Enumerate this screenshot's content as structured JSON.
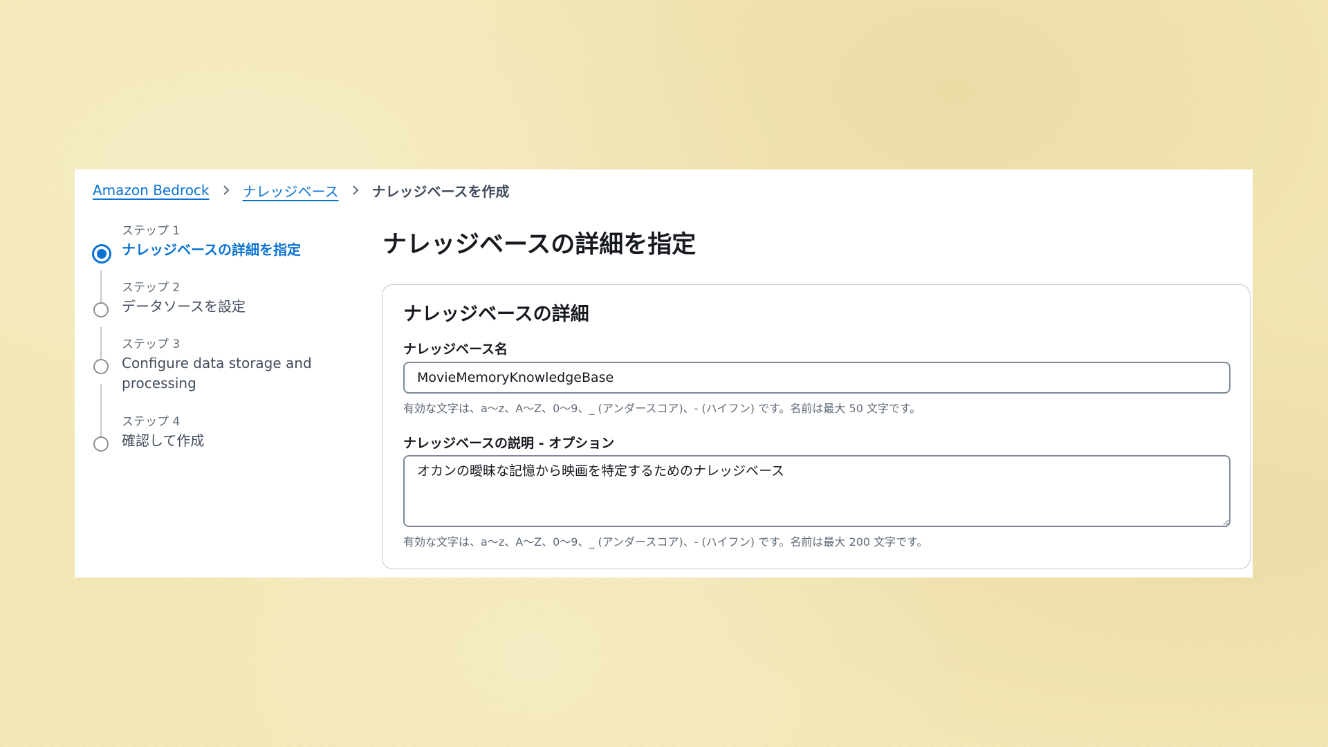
{
  "breadcrumb": {
    "items": [
      {
        "label": "Amazon Bedrock"
      },
      {
        "label": "ナレッジベース"
      }
    ],
    "current": "ナレッジベースを作成"
  },
  "steps": [
    {
      "label": "ステップ 1",
      "title": "ナレッジベースの詳細を指定",
      "state": "active"
    },
    {
      "label": "ステップ 2",
      "title": "データソースを設定",
      "state": "inactive"
    },
    {
      "label": "ステップ 3",
      "title": "Configure data storage and processing",
      "state": "inactive"
    },
    {
      "label": "ステップ 4",
      "title": "確認して作成",
      "state": "inactive"
    }
  ],
  "page_title": "ナレッジベースの詳細を指定",
  "card": {
    "title": "ナレッジベースの詳細",
    "name_field": {
      "label": "ナレッジベース名",
      "value": "MovieMemoryKnowledgeBase",
      "hint": "有効な文字は、a〜z、A〜Z、0〜9、_ (アンダースコア)、- (ハイフン) です。名前は最大 50 文字です。"
    },
    "description_field": {
      "label": "ナレッジベースの説明 - オプション",
      "value": "オカンの曖昧な記憶から映画を特定するためのナレッジベース",
      "hint": "有効な文字は、a〜z、A〜Z、0〜9、_ (アンダースコア)、- (ハイフン) です。名前は最大 200 文字です。"
    }
  },
  "colors": {
    "accent": "#0972d3",
    "background": "#f3e7b5",
    "panel": "#ffffff",
    "text": "#16191f",
    "muted": "#5f6b7a"
  },
  "icons": {
    "breadcrumb_separator": "chevron-right-icon",
    "active_step": "radio-selected-icon",
    "inactive_step": "radio-empty-icon"
  }
}
